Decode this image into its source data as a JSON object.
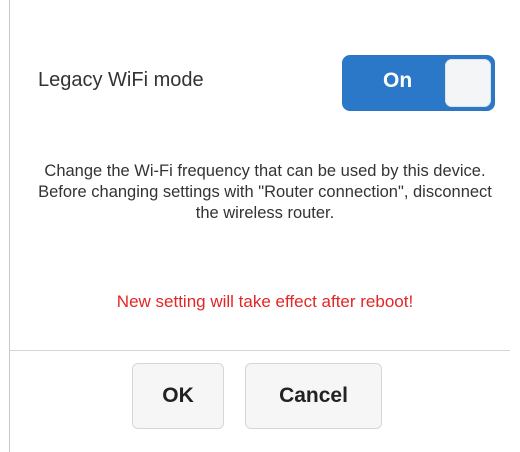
{
  "dialog": {
    "setting_label": "Legacy WiFi mode",
    "toggle": {
      "state_label": "On",
      "enabled": true
    },
    "description": "Change the Wi-Fi frequency that can be used by this device. Before changing settings with \"Router connection\", disconnect the wireless router.",
    "warning": "New setting will take effect after reboot!",
    "buttons": {
      "ok_label": "OK",
      "cancel_label": "Cancel"
    },
    "colors": {
      "toggle_on": "#2b77c8",
      "warning_text": "#e32626",
      "button_bg": "#f6f6f6"
    }
  }
}
